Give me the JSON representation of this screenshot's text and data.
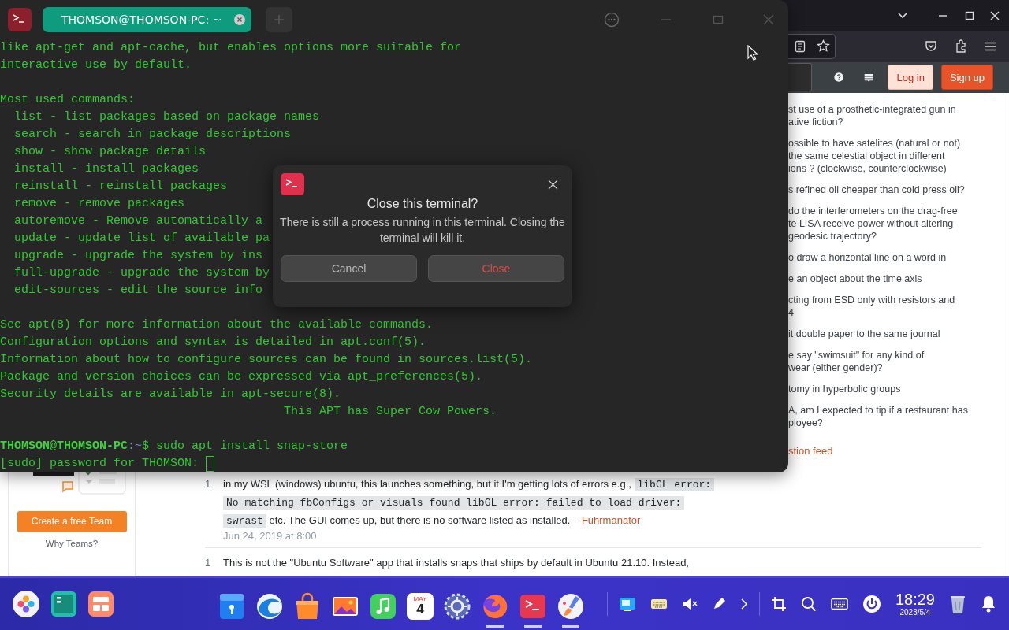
{
  "terminal": {
    "tab": {
      "title": "THOMSON@THOMSON-PC: ~",
      "selected": true
    },
    "blocks": [
      {
        "lines": [
          "like apt-get and apt-cache, but enables options more suitable for",
          "interactive use by default."
        ]
      },
      {
        "lines": [
          "Most used commands:",
          "  list - list packages based on package names",
          "  search - search in package descriptions",
          "  show - show package details",
          "  install - install packages",
          "  reinstall - reinstall packages",
          "  remove - remove packages",
          "  autoremove - Remove automatically a",
          "  update - update list of available pa",
          "  upgrade - upgrade the system by ins",
          "  full-upgrade - upgrade the system by",
          "  edit-sources - edit the source info"
        ]
      },
      {
        "lines": [
          "See apt(8) for more information about the available commands.",
          "Configuration options and syntax is detailed in apt.conf(5).",
          "Information about how to configure sources can be found in sources.list(5).",
          "Package and version choices can be expressed via apt_preferences(5).",
          "Security details are available in apt-secure(8).",
          "                                        This APT has Super Cow Powers."
        ]
      }
    ],
    "prompt": {
      "user": "THOMSON@THOMSON-PC",
      "path": ":~",
      "command": "$ sudo apt install snap-store"
    },
    "input_line": "[sudo] password for THOMSON:"
  },
  "dialog": {
    "title": "Close this terminal?",
    "message": "There is still a process running in this terminal. Closing the terminal will kill it.",
    "buttons": [
      {
        "label": "Cancel",
        "kind": "normal"
      },
      {
        "label": "Close",
        "kind": "warning"
      }
    ]
  },
  "browser": {
    "header_buttons": [
      {
        "label": "Log in",
        "kind": "secondary"
      },
      {
        "label": "Sign up",
        "kind": "primary"
      }
    ],
    "questions": [
      "st use of a prosthetic-integrated gun in\native fiction?",
      "ossible to have satelites (natural or not)\nthe same celestial object in different\nions ? (clockwise, counterclockwise)",
      "s refined oil cheaper than cold press oil?",
      "do the interferometers on the drag-free\nte LISA receive power without altering\ngeodesic trajectory?",
      "o draw a horizontal line on a word in",
      "e an object about the time axis",
      "cting from ESD only with resistors and\n4",
      "it double paper to the same journal",
      "e say \"swimsuit\" for any kind of\nwear (either gender)?",
      "tomy in hyperbolic groups",
      "A, am I expected to tip if a restaurant has\nployee?"
    ],
    "feed_link": "stion feed",
    "sidebar": {
      "team_button": "Create a free Team",
      "why_link": "Why Teams?"
    },
    "comments": [
      {
        "score": "1",
        "segments": [
          {
            "kind": "text",
            "text": "in my WSL (windows) ubuntu, this launches something, but it I'm getting lots of errors e.g., "
          },
          {
            "kind": "code",
            "text": "libGL error: No matching fbConfigs or visuals found libGL error: failed to load driver: swrast"
          },
          {
            "kind": "text",
            "text": " etc. The GUI comes up, but there is no software listed as installed. – "
          },
          {
            "kind": "user",
            "text": "Fuhrmanator"
          }
        ],
        "date": "Jun 24, 2019 at 8:00"
      },
      {
        "score": "1",
        "segments": [
          {
            "kind": "text",
            "text": "This is not the \"Ubuntu Software\" app that installs snaps that ships by default in Ubuntu 21.10. Instead,"
          }
        ]
      }
    ]
  },
  "taskbar": {
    "apps": [
      {
        "kind": "box",
        "running": false
      },
      {
        "kind": "swirl",
        "running": false
      },
      {
        "kind": "store",
        "running": false
      },
      {
        "kind": "photos",
        "running": false
      },
      {
        "kind": "music",
        "running": false
      },
      {
        "kind": "calendar",
        "running": false
      },
      {
        "kind": "settings",
        "running": false
      },
      {
        "kind": "globe",
        "running": true
      },
      {
        "kind": "terminal",
        "running": true
      },
      {
        "kind": "paint",
        "running": true
      }
    ],
    "calendar": {
      "month": "MAY",
      "day": "4"
    },
    "clock": {
      "time": "18:29",
      "date": "2023/5/4"
    }
  }
}
